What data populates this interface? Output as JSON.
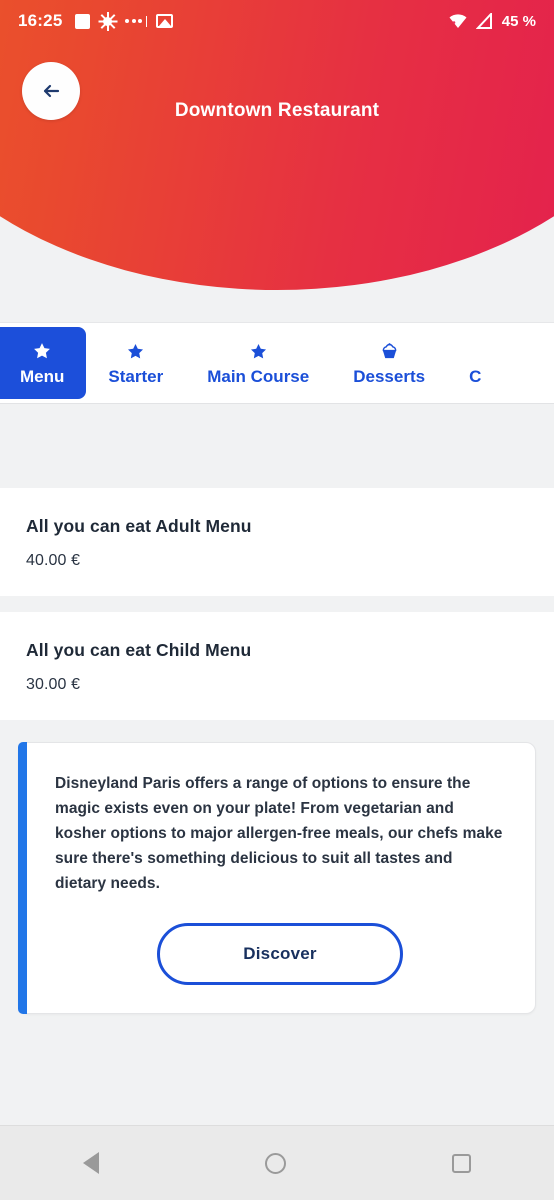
{
  "status_bar": {
    "time": "16:25",
    "battery": "45 %",
    "left_icons": [
      "square-badge-icon",
      "brightness-sun-icon",
      "more-dots-icon",
      "image-icon"
    ],
    "right_icons": [
      "wifi-icon",
      "signal-icon"
    ]
  },
  "header": {
    "title": "Downtown Restaurant",
    "back_icon": "arrow-left-icon",
    "gradient_start": "#EC5C27",
    "gradient_end": "#E31B52"
  },
  "tabs": {
    "active_index": 0,
    "accent_color": "#1B4FD8",
    "items": [
      {
        "label": "Menu",
        "icon": "star-icon"
      },
      {
        "label": "Starter",
        "icon": "star-icon"
      },
      {
        "label": "Main Course",
        "icon": "star-icon"
      },
      {
        "label": "Desserts",
        "icon": "cupcake-icon"
      },
      {
        "label": "C",
        "icon": "partial-icon"
      }
    ]
  },
  "menu_items": [
    {
      "title": "All you can eat Adult Menu",
      "price": "40.00 €"
    },
    {
      "title": "All you can eat Child Menu",
      "price": "30.00 €"
    }
  ],
  "info_card": {
    "accent_color": "#2176E8",
    "text": "Disneyland Paris offers a range of options to ensure the magic exists even on your plate! From vegetarian and kosher options to major allergen-free meals, our chefs make sure there's something delicious to suit all tastes and dietary needs.",
    "button_label": "Discover"
  },
  "nav_bar": {
    "back": "triangle-back-icon",
    "home": "circle-home-icon",
    "recents": "square-recents-icon"
  }
}
